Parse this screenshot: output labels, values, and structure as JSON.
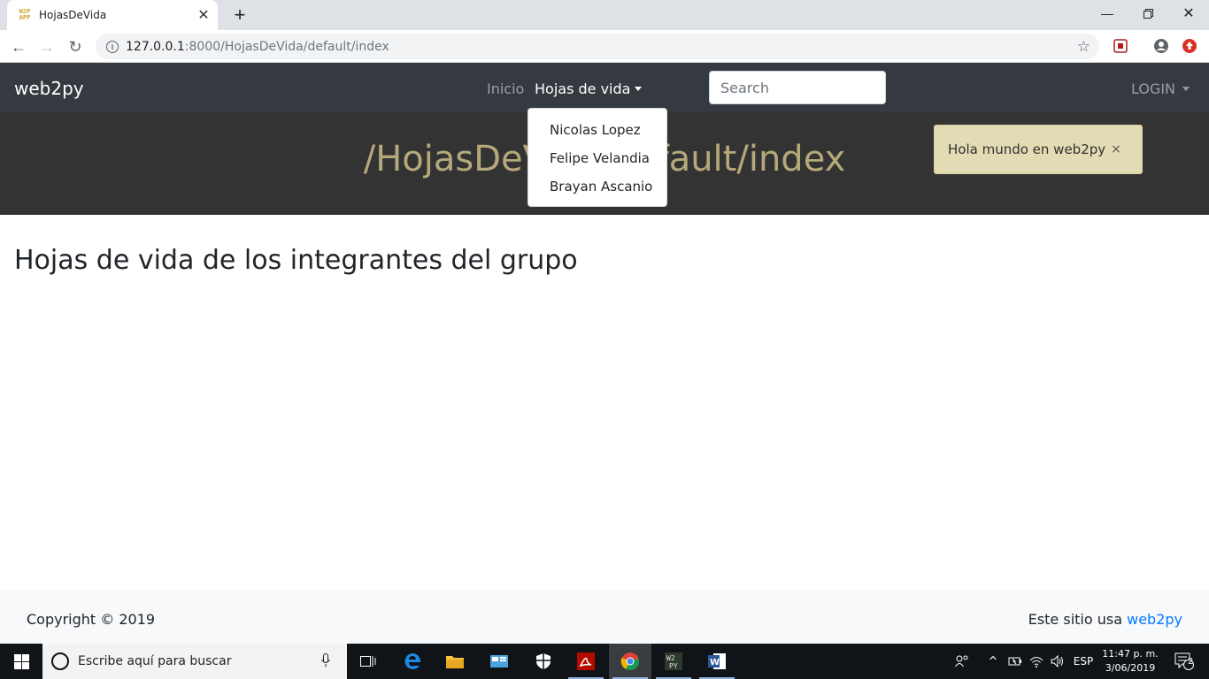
{
  "browser": {
    "tab_title": "HojasDeVida",
    "favicon_text": "W2P APP",
    "url_host": "127.0.0.1",
    "url_path": ":8000/HojasDeVida/default/index"
  },
  "site": {
    "brand": "web2py",
    "nav": {
      "inicio": "Inicio",
      "hojas": "Hojas de vida",
      "login": "LOGIN"
    },
    "search_placeholder": "Search",
    "dropdown": [
      "Nicolas Lopez",
      "Felipe Velandia",
      "Brayan Ascanio"
    ],
    "hero_title": "/HojasDeVida/default/index",
    "flash": "Hola mundo en web2py",
    "flash_close": "×",
    "heading": "Hojas de vida de los integrantes del grupo",
    "footer": {
      "copyright": "Copyright © 2019",
      "powered_prefix": "Este sitio usa",
      "powered_link": "web2py"
    }
  },
  "taskbar": {
    "search_text": "Escribe aquí para buscar",
    "lang": "ESP",
    "time": "11:47 p. m.",
    "date": "3/06/2019",
    "notif_count": "2"
  },
  "colors": {
    "navbar_bg": "#343a40",
    "hero_bg": "#333333",
    "hero_title": "#b5a87a",
    "flash_bg": "#e3dbb3",
    "link": "#007bff",
    "taskbar_bg": "#101418"
  }
}
